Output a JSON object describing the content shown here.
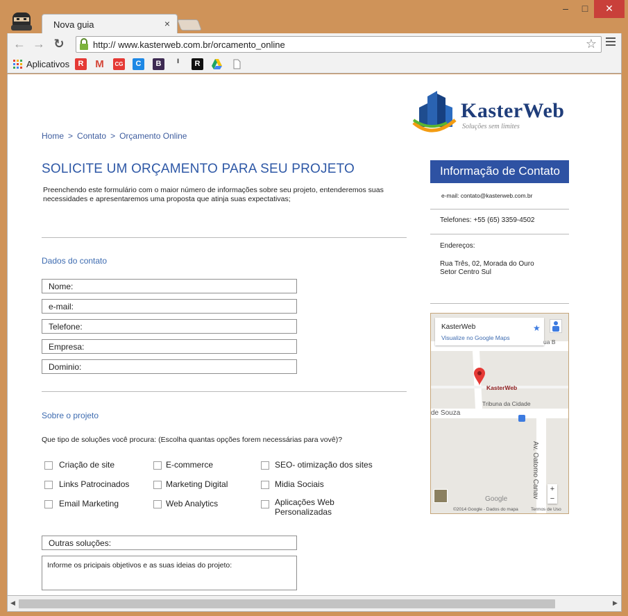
{
  "browser": {
    "tab_title": "Nova guia",
    "tab_close": "×",
    "url": "http:// www.kasterweb.com.br/orcamento_online",
    "window_min": "–",
    "window_max": "□",
    "window_close": "✕",
    "bookmarks_label": "Aplicativos"
  },
  "logo": {
    "name": "KasterWeb",
    "tagline": "Soluções sem limites"
  },
  "breadcrumb": [
    "Home",
    "Contato",
    "Orçamento Online"
  ],
  "breadcrumb_sep": ">",
  "page_title": "SOLICITE UM ORÇAMENTO PARA SEU PROJETO",
  "intro": "Preenchendo este formulário com o maior número de informações sobre seu projeto, entenderemos suas necessidades e apresentaremos uma proposta que atinja suas expectativas;",
  "contact_section": {
    "title": "Dados do contato",
    "fields": [
      "Nome:",
      "e-mail:",
      "Telefone:",
      "Empresa:",
      "Dominio:"
    ]
  },
  "project_section": {
    "title": "Sobre o projeto",
    "question": "Que tipo de soluções você procura: (Escolha quantas opções forem necessárias para vovê)?",
    "options": [
      [
        "Criação de site",
        "E-commerce",
        "SEO- otimização dos sites"
      ],
      [
        "Links Patrocinados",
        "Marketing Digital",
        "Midia Sociais"
      ],
      [
        "Email Marketing",
        "Web Analytics",
        "Aplicações Web Personalizadas"
      ]
    ],
    "other": "Outras soluções:",
    "objectives": "Informe os pricipais objetivos e as suas ideias do projeto:"
  },
  "sidebar": {
    "header": "Informação de Contato",
    "email": "e-mail: contato@kasterweb.com.br",
    "phone": "Telefones: +55 (65) 3359-4502",
    "address_label": "Endereços:",
    "address_line1": "Rua Três, 02, Morada do Ouro",
    "address_line2": "Setor Centro Sul"
  },
  "map": {
    "card_title": "KasterWeb",
    "card_link": "Visualize no Google Maps",
    "pin_label": "KasterWeb",
    "street_rua": "ua B",
    "place": "Tribuna da Cidade",
    "street_souza": "de Souza",
    "street_av": "Av. Oatomo Canav",
    "logo": "Google",
    "footer_left": "©2014 Google - Dados do mapa",
    "footer_right": "Termos de Uso",
    "zoom_in": "+",
    "zoom_out": "−"
  },
  "colors": {
    "accent": "#2e52a3",
    "link": "#3d5c9e",
    "frame": "#cf9359"
  }
}
